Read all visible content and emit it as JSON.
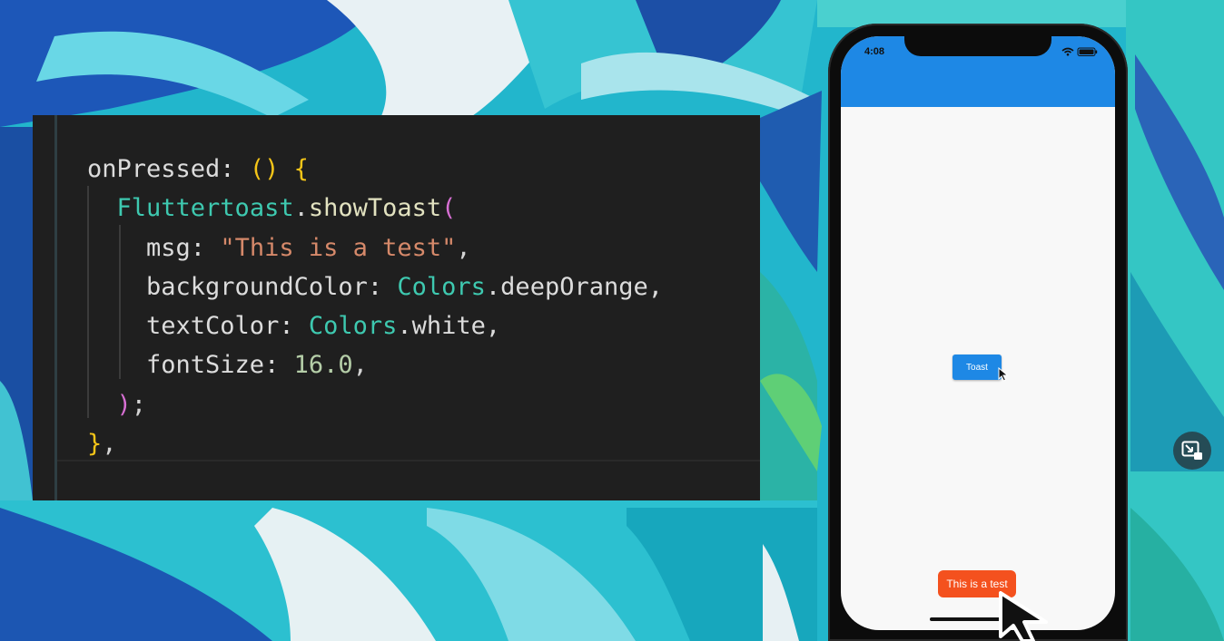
{
  "code": {
    "lines": [
      [
        {
          "t": "onPressed: ",
          "c": "c-key"
        },
        {
          "t": "()",
          "c": "c-paren"
        },
        {
          "t": " ",
          "c": "c-punct"
        },
        {
          "t": "{",
          "c": "c-paren"
        }
      ],
      [
        {
          "t": "  ",
          "c": "c-punct"
        },
        {
          "t": "Fluttertoast",
          "c": "c-class"
        },
        {
          "t": ".",
          "c": "c-punct"
        },
        {
          "t": "showToast",
          "c": "c-fn"
        },
        {
          "t": "(",
          "c": "c-paren2"
        }
      ],
      [
        {
          "t": "    msg: ",
          "c": "c-key"
        },
        {
          "t": "\"This is a test\"",
          "c": "c-str"
        },
        {
          "t": ",",
          "c": "c-punct"
        }
      ],
      [
        {
          "t": "    backgroundColor: ",
          "c": "c-key"
        },
        {
          "t": "Colors",
          "c": "c-class"
        },
        {
          "t": ".deepOrange,",
          "c": "c-key"
        }
      ],
      [
        {
          "t": "    textColor: ",
          "c": "c-key"
        },
        {
          "t": "Colors",
          "c": "c-class"
        },
        {
          "t": ".white,",
          "c": "c-key"
        }
      ],
      [
        {
          "t": "    fontSize: ",
          "c": "c-key"
        },
        {
          "t": "16.0",
          "c": "c-num"
        },
        {
          "t": ",",
          "c": "c-punct"
        }
      ],
      [
        {
          "t": "  ",
          "c": "c-punct"
        },
        {
          "t": ")",
          "c": "c-paren2"
        },
        {
          "t": ";",
          "c": "c-punct"
        }
      ],
      [
        {
          "t": "}",
          "c": "c-paren"
        },
        {
          "t": ",",
          "c": "c-punct"
        }
      ]
    ]
  },
  "phone": {
    "status_time": "4:08",
    "button_label": "Toast",
    "toast_text": "This is a test",
    "appbar_color": "#1e88e5",
    "toast_color": "#f4511e"
  },
  "icons": {
    "wifi": "wifi-icon",
    "battery": "battery-icon",
    "pip": "picture-in-picture-icon",
    "cursor": "mouse-cursor-icon"
  }
}
